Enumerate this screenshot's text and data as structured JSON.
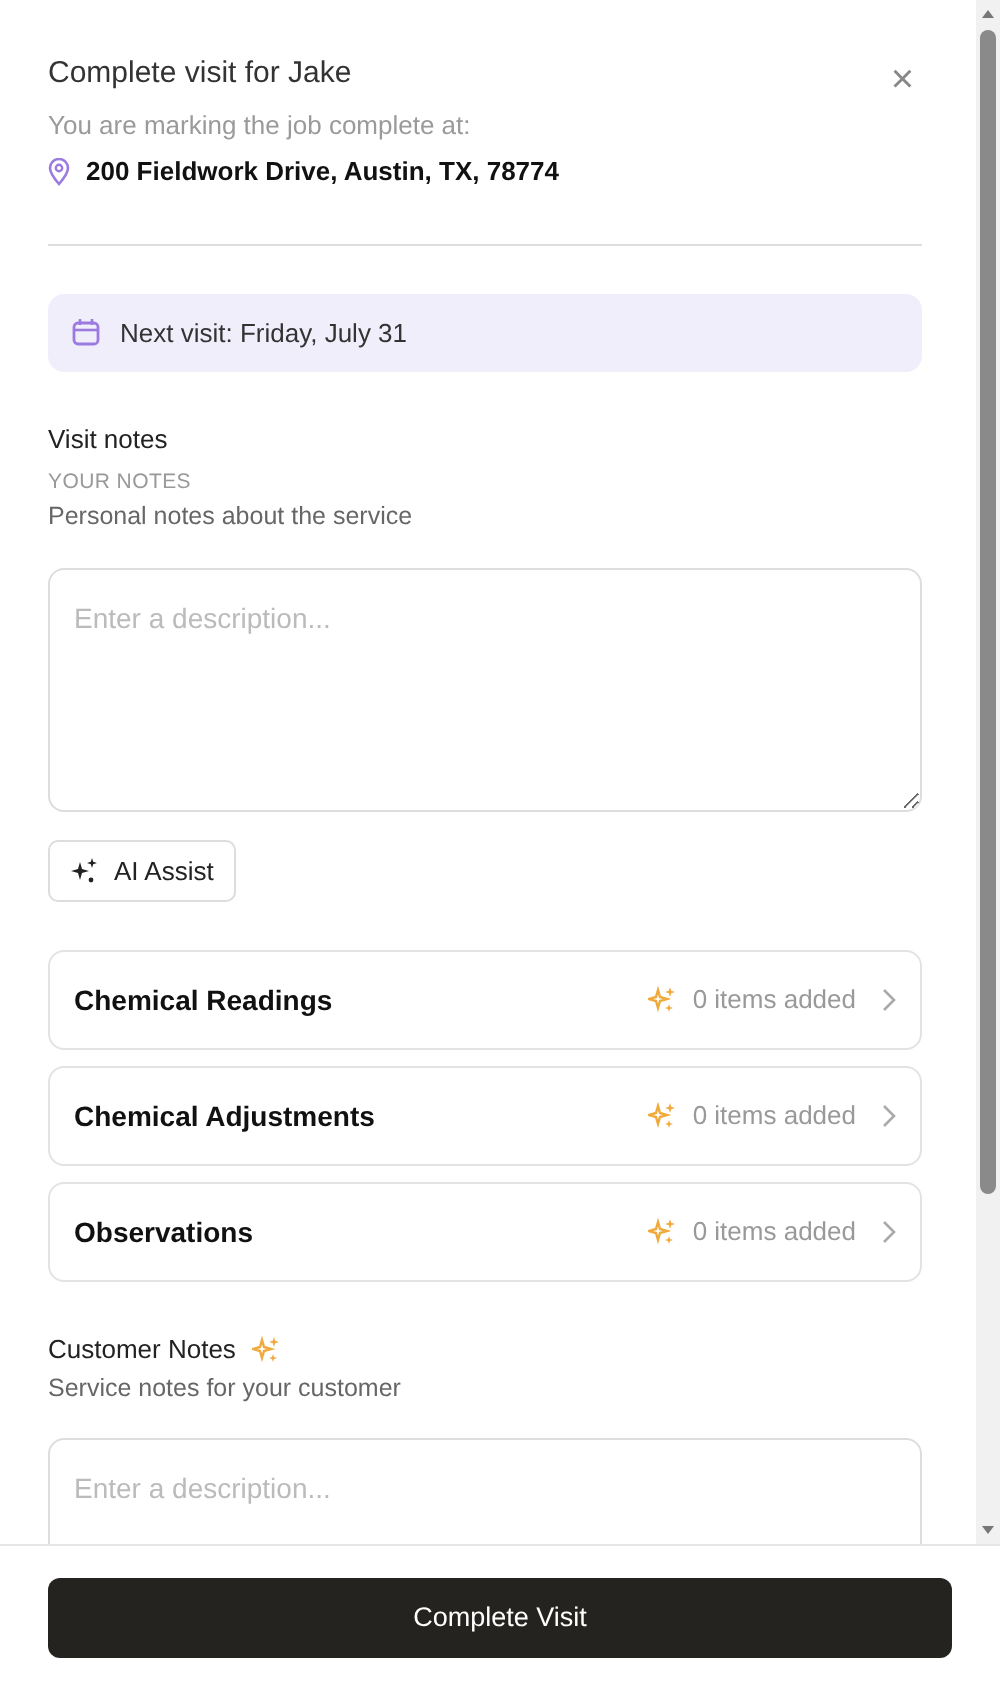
{
  "dialog": {
    "title": "Complete visit for Jake",
    "subtitle": "You are marking the job complete at:",
    "address": "200 Fieldwork Drive, Austin, TX, 78774",
    "close": "×"
  },
  "next_visit": "Next visit: Friday, July 31",
  "visit_notes": {
    "title": "Visit notes",
    "overline": "YOUR NOTES",
    "description": "Personal notes about the service",
    "placeholder": "Enter a description...",
    "assist_button": "AI Assist"
  },
  "sections": [
    {
      "title": "Chemical Readings",
      "count": "0 items added"
    },
    {
      "title": "Chemical Adjustments",
      "count": "0 items added"
    },
    {
      "title": "Observations",
      "count": "0 items added"
    }
  ],
  "customer_notes": {
    "title": "Customer Notes",
    "description": "Service notes for your customer",
    "placeholder": "Enter a description..."
  },
  "footer": {
    "button": "Complete Visit"
  }
}
